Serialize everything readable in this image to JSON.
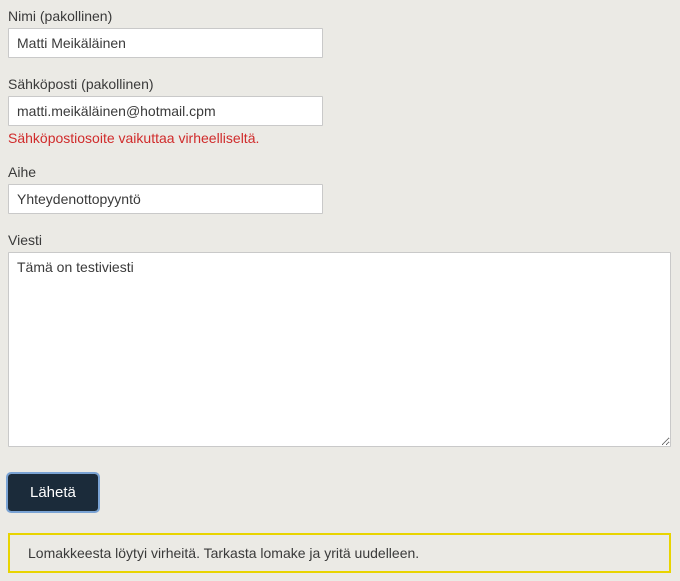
{
  "fields": {
    "name": {
      "label": "Nimi (pakollinen)",
      "value": "Matti Meikäläinen"
    },
    "email": {
      "label": "Sähköposti (pakollinen)",
      "value": "matti.meikäläinen@hotmail.cpm",
      "error": "Sähköpostiosoite vaikuttaa virheelliseltä."
    },
    "subject": {
      "label": "Aihe",
      "value": "Yhteydenottopyyntö"
    },
    "message": {
      "label": "Viesti",
      "value": "Tämä on testiviesti"
    }
  },
  "submit_label": "Lähetä",
  "form_error": "Lomakkeesta löytyi virheitä. Tarkasta lomake ja yritä uudelleen."
}
